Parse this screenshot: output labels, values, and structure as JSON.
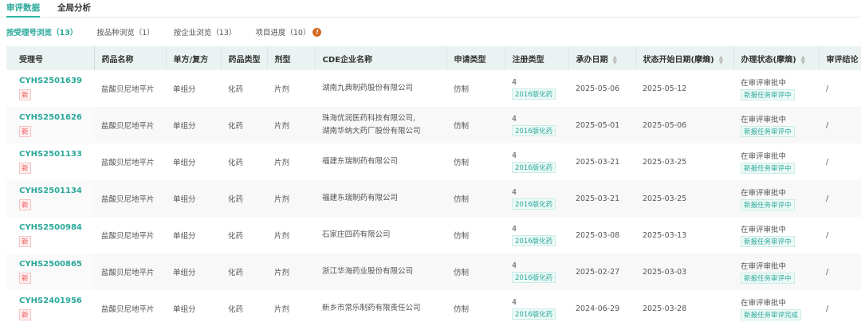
{
  "tabs": [
    "审评数据",
    "全局分析"
  ],
  "subtabs": [
    "按受理号浏览（13）",
    "按品种浏览（1）",
    "按企业浏览（13）",
    "项目进度（10）"
  ],
  "info_icon": "!",
  "columns": [
    "受理号",
    "药品名称",
    "单方/复方",
    "药品类型",
    "剂型",
    "CDE企业名称",
    "申请类型",
    "注册类型",
    "承办日期",
    "状态开始日期(摩熵)",
    "办理状态(摩熵)",
    "审评结论"
  ],
  "new_badge": "新",
  "rows": [
    {
      "id": "CYHS2501639",
      "drug": "盐酸贝尼地平片",
      "comp": "单组分",
      "type": "化药",
      "form": "片剂",
      "company": [
        "湖南九典制药股份有限公司"
      ],
      "apply": "仿制",
      "reg": "4",
      "reg_tag": "2016版化药",
      "date1": "2025-05-06",
      "date2": "2025-05-12",
      "status": "在审评审批中",
      "status_tag": "新报任务审评中",
      "result": "/"
    },
    {
      "id": "CYHS2501626",
      "drug": "盐酸贝尼地平片",
      "comp": "单组分",
      "type": "化药",
      "form": "片剂",
      "company": [
        "珠海优润医药科技有限公司,",
        "湖南华纳大药厂股份有限公司"
      ],
      "apply": "仿制",
      "reg": "4",
      "reg_tag": "2016版化药",
      "date1": "2025-05-01",
      "date2": "2025-05-06",
      "status": "在审评审批中",
      "status_tag": "新报任务审评中",
      "result": "/"
    },
    {
      "id": "CYHS2501133",
      "drug": "盐酸贝尼地平片",
      "comp": "单组分",
      "type": "化药",
      "form": "片剂",
      "company": [
        "福建东瑞制药有限公司"
      ],
      "apply": "仿制",
      "reg": "4",
      "reg_tag": "2016版化药",
      "date1": "2025-03-21",
      "date2": "2025-03-25",
      "status": "在审评审批中",
      "status_tag": "新报任务审评中",
      "result": "/"
    },
    {
      "id": "CYHS2501134",
      "drug": "盐酸贝尼地平片",
      "comp": "单组分",
      "type": "化药",
      "form": "片剂",
      "company": [
        "福建东瑞制药有限公司"
      ],
      "apply": "仿制",
      "reg": "4",
      "reg_tag": "2016版化药",
      "date1": "2025-03-21",
      "date2": "2025-03-25",
      "status": "在审评审批中",
      "status_tag": "新报任务审评中",
      "result": "/"
    },
    {
      "id": "CYHS2500984",
      "drug": "盐酸贝尼地平片",
      "comp": "单组分",
      "type": "化药",
      "form": "片剂",
      "company": [
        "石家庄四药有限公司"
      ],
      "apply": "仿制",
      "reg": "4",
      "reg_tag": "2016版化药",
      "date1": "2025-03-08",
      "date2": "2025-03-13",
      "status": "在审评审批中",
      "status_tag": "新报任务审评中",
      "result": "/"
    },
    {
      "id": "CYHS2500865",
      "drug": "盐酸贝尼地平片",
      "comp": "单组分",
      "type": "化药",
      "form": "片剂",
      "company": [
        "浙江华海药业股份有限公司"
      ],
      "apply": "仿制",
      "reg": "4",
      "reg_tag": "2016版化药",
      "date1": "2025-02-27",
      "date2": "2025-03-03",
      "status": "在审评审批中",
      "status_tag": "新报任务审评中",
      "result": "/"
    },
    {
      "id": "CYHS2401956",
      "drug": "盐酸贝尼地平片",
      "comp": "单组分",
      "type": "化药",
      "form": "片剂",
      "company": [
        "新乡市常乐制药有限责任公司"
      ],
      "apply": "仿制",
      "reg": "4",
      "reg_tag": "2016版化药",
      "date1": "2024-06-29",
      "date2": "2025-03-28",
      "status": "在审评审批中",
      "status_tag": "新报任务审评完成",
      "result": "/"
    }
  ]
}
